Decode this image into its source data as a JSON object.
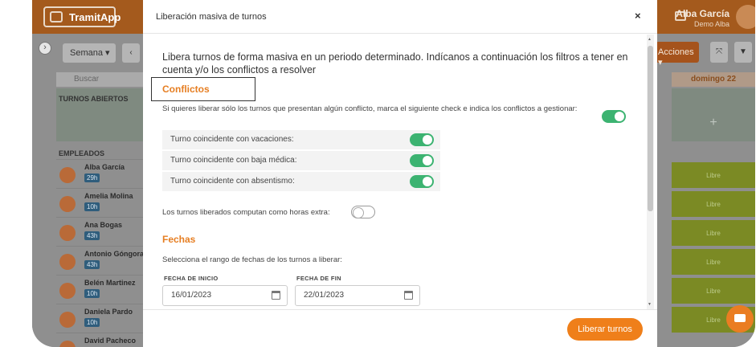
{
  "app": {
    "name": "TramitApp",
    "user_name": "Alba García",
    "user_sub": "Demo Alba"
  },
  "background": {
    "week_select": "Semana ▾",
    "prev": "‹",
    "search": "Buscar",
    "open_shifts": "TURNOS ABIERTOS",
    "employees_header": "EMPLEADOS",
    "employees": [
      {
        "name": "Alba García",
        "hours": "29h"
      },
      {
        "name": "Amelia Molina",
        "hours": "10h"
      },
      {
        "name": "Ana Bogas",
        "hours": "43h"
      },
      {
        "name": "Antonio Góngora",
        "hours": "43h"
      },
      {
        "name": "Belén Martinez",
        "hours": "10h"
      },
      {
        "name": "Daniela Pardo",
        "hours": "10h"
      },
      {
        "name": "David Pacheco",
        "hours": ""
      }
    ],
    "actions_button": "Acciones ▾",
    "fullscreen_icon": "⤧",
    "filter_icon": "▼",
    "day_header": "domingo 22",
    "day_open": "+",
    "libre_cells": [
      "Libre",
      "Libre",
      "Libre",
      "Libre",
      "Libre",
      "Libre"
    ]
  },
  "modal": {
    "title": "Liberación masiva de turnos",
    "close": "×",
    "intro": "Libera turnos de forma masiva en un periodo determinado. Indícanos a continuación los filtros a tener en cuenta y/o los conflictos a resolver",
    "conflicts_title": "Conflictos",
    "conflicts_desc": "Si quieres liberar sólo los turnos que presentan algún conflicto, marca el siguiente check e indica los conflictos a gestionar:",
    "conflicts_enabled": true,
    "conflict_options": [
      {
        "label": "Turno coincidente con vacaciones:",
        "on": true
      },
      {
        "label": "Turno coincidente con baja médica:",
        "on": true
      },
      {
        "label": "Turno coincidente con absentismo:",
        "on": true
      }
    ],
    "extra_hours_label": "Los turnos liberados computan como horas extra:",
    "extra_hours_on": false,
    "dates_title": "Fechas",
    "dates_desc": "Selecciona el rango de fechas de los turnos a liberar:",
    "start_label": "FECHA DE INICIO",
    "start_value": "16/01/2023",
    "end_label": "FECHA DE FIN",
    "end_value": "22/01/2023",
    "submit": "Liberar turnos"
  },
  "colors": {
    "accent": "#ef7f1a",
    "toggle_on": "#3cb371"
  }
}
